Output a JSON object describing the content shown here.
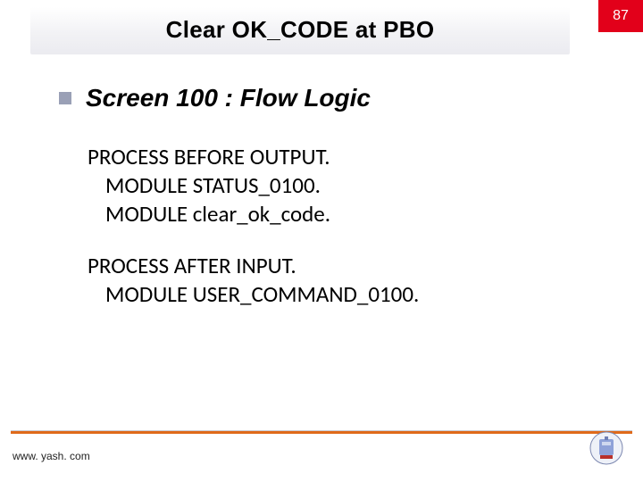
{
  "page_number": "87",
  "title": "Clear OK_CODE at PBO",
  "subtitle": "Screen 100 : Flow Logic",
  "code": {
    "pbo_header": "PROCESS BEFORE OUTPUT.",
    "pbo_line1": "MODULE STATUS_0100.",
    "pbo_line2": "MODULE clear_ok_code.",
    "pai_header": "PROCESS AFTER INPUT.",
    "pai_line1": "MODULE USER_COMMAND_0100."
  },
  "footer_url": "www. yash. com"
}
